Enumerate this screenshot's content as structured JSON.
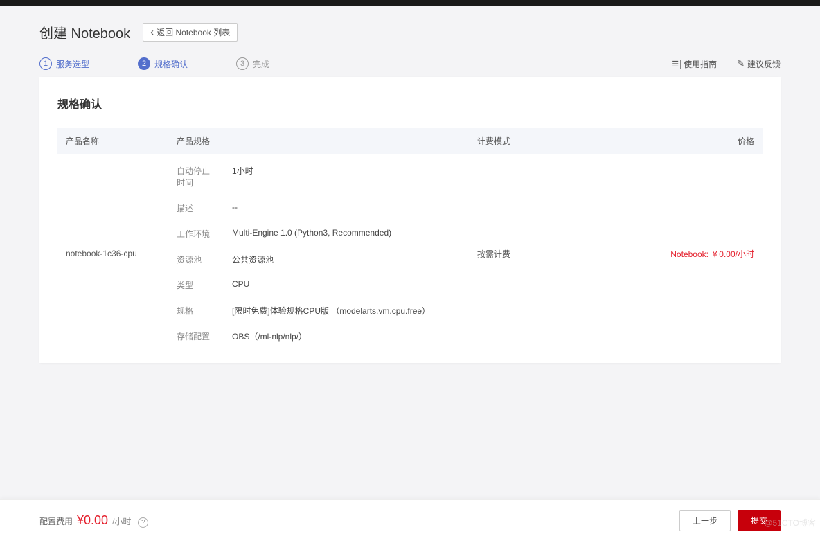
{
  "header": {
    "title": "创建 Notebook",
    "back_label": "返回 Notebook 列表"
  },
  "steps": {
    "step1": {
      "num": "1",
      "label": "服务选型"
    },
    "step2": {
      "num": "2",
      "label": "规格确认"
    },
    "step3": {
      "num": "3",
      "label": "完成"
    }
  },
  "links": {
    "guide": "使用指南",
    "feedback": "建议反馈"
  },
  "section": {
    "title": "规格确认"
  },
  "table": {
    "headers": {
      "name": "产品名称",
      "spec": "产品规格",
      "billing": "计费模式",
      "price": "价格"
    },
    "row": {
      "product_name": "notebook-1c36-cpu",
      "specs": {
        "auto_stop": {
          "key": "自动停止时间",
          "val": "1小时"
        },
        "desc": {
          "key": "描述",
          "val": "--"
        },
        "env": {
          "key": "工作环境",
          "val": "Multi-Engine 1.0 (Python3, Recommended)"
        },
        "pool": {
          "key": "资源池",
          "val": "公共资源池"
        },
        "type": {
          "key": "类型",
          "val": "CPU"
        },
        "flavor": {
          "key": "规格",
          "val": "[限时免费]体验规格CPU版 （modelarts.vm.cpu.free）"
        },
        "storage": {
          "key": "存储配置",
          "val": "OBS（/ml-nlp/nlp/）"
        }
      },
      "billing": "按需计费",
      "price": "Notebook:  ￥0.00/小时"
    }
  },
  "footer": {
    "cost_label": "配置费用",
    "cost_amount": "¥0.00",
    "cost_unit": "/小时",
    "help": "?",
    "prev": "上一步",
    "submit": "提交"
  },
  "watermark": "@51CTO博客"
}
